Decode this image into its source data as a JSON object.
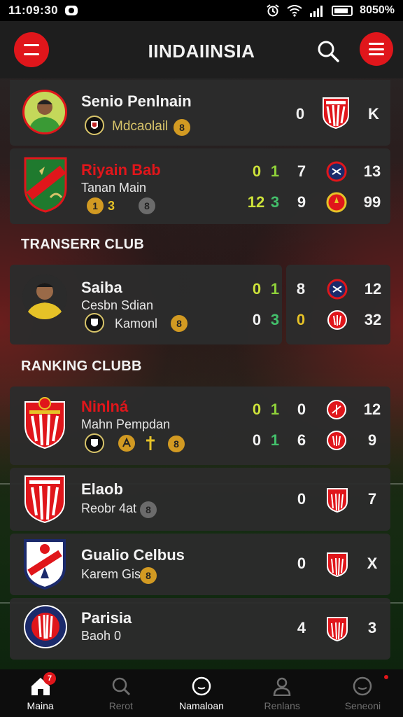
{
  "status_bar": {
    "time": "11:09:30",
    "battery": "8050%"
  },
  "header": {
    "title": "IINDAIINSIA"
  },
  "top_player": {
    "name": "Senio Penlnain",
    "sub": "Mdcaolail",
    "chip": "8",
    "score": "0",
    "right": "K"
  },
  "featured_club": {
    "name": "Riyain Bab",
    "sub": "Tanan Main",
    "chips": [
      "1",
      "3",
      "8"
    ],
    "row1": {
      "a": "0",
      "b": "1",
      "c": "7",
      "right": "13"
    },
    "row2": {
      "a": "12",
      "b": "3",
      "c": "9",
      "right": "99"
    }
  },
  "transfer_section": {
    "title": "TRANSERR CLUB"
  },
  "transfer_player": {
    "name": "Saiba",
    "sub": "Cesbn Sdian",
    "sub2": "Kamonl",
    "chip": "8",
    "row1": {
      "a": "0",
      "b": "1"
    },
    "row2": {
      "a": "0",
      "b": "3"
    },
    "side_row1": {
      "a": "8",
      "right": "12"
    },
    "side_row2": {
      "a": "0",
      "right": "32"
    }
  },
  "ranking_section": {
    "title": "RANKING CLUBB"
  },
  "ranking": [
    {
      "name": "Ninlná",
      "sub": "Mahn Pempdan",
      "chips": [
        "8"
      ],
      "row1": {
        "a": "0",
        "b": "1",
        "c": "0",
        "right": "12"
      },
      "row2": {
        "a": "0",
        "b": "1",
        "c": "6",
        "right": "9"
      }
    },
    {
      "name": "Elaob",
      "sub": "Reobr 4at",
      "chip": "8",
      "score": "0",
      "right": "7"
    },
    {
      "name": "Gualio Celbus",
      "sub": "Karem Gis",
      "chip": "8",
      "score": "0",
      "right": "X"
    },
    {
      "name": "Parisia",
      "sub": "Baoh 0",
      "score": "4",
      "right": "3"
    }
  ],
  "bottom_nav": [
    {
      "label": "Maina",
      "badge": "7"
    },
    {
      "label": "Rerot"
    },
    {
      "label": "Namaloan"
    },
    {
      "label": "Renlans"
    },
    {
      "label": "Seneoni"
    }
  ],
  "colors": {
    "accent_red": "#e0161b",
    "card": "#2c2c2c",
    "green": "#8fd13a",
    "gold": "#d29a22"
  }
}
